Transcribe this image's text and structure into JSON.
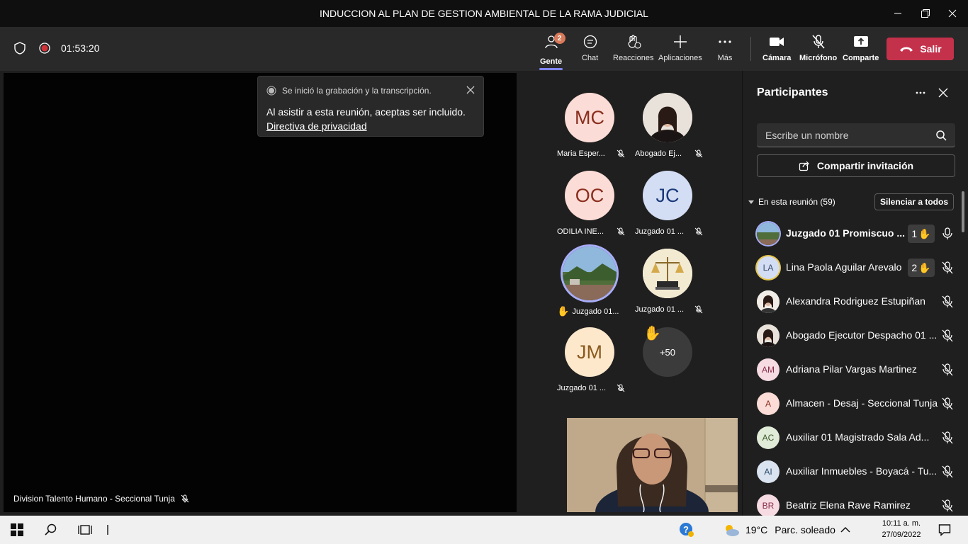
{
  "window": {
    "title": "INDUCCION AL PLAN DE GESTION AMBIENTAL DE LA RAMA JUDICIAL"
  },
  "toolbar": {
    "timer": "01:53:20",
    "people": {
      "label": "Gente",
      "badge": "2"
    },
    "chat": "Chat",
    "reactions": "Reacciones",
    "apps": "Aplicaciones",
    "more": "Más",
    "camera": "Cámara",
    "mic": "Micrófono",
    "share": "Comparte",
    "leave": "Salir"
  },
  "toast": {
    "header": "Se inició la grabación y la transcripción.",
    "body": "Al asistir a esta reunión, aceptas ser incluido.",
    "link": "Directiva de privacidad"
  },
  "stage": {
    "label": "Division Talento Humano - Seccional Tunja"
  },
  "gallery": [
    {
      "initials": "MC",
      "name": "Maria Esper...",
      "bg": "#fcdcd6",
      "fg": "#8a2e1e"
    },
    {
      "initials": "",
      "name": "Abogado Ej...",
      "bg": "#d8c8b8",
      "fg": "#000"
    },
    {
      "initials": "OC",
      "name": "ODILIA INE...",
      "bg": "#fcdcd6",
      "fg": "#8a2e1e"
    },
    {
      "initials": "JC",
      "name": "Juzgado 01 ...",
      "bg": "#d3def4",
      "fg": "#1b3a7a"
    },
    {
      "initials": "",
      "name": "Juzgado 01...",
      "bg": "#7f9a7f",
      "fg": "#000"
    },
    {
      "initials": "",
      "name": "Juzgado 01 ...",
      "bg": "#f3ead2",
      "fg": "#000"
    },
    {
      "initials": "JM",
      "name": "Juzgado 01 ...",
      "bg": "#fde8cc",
      "fg": "#8a5a1e"
    },
    {
      "initials": "+50",
      "name": "",
      "bg": "#3b3b3b",
      "fg": "#fff"
    }
  ],
  "panel": {
    "title": "Participantes",
    "search_placeholder": "Escribe un nombre",
    "share_invite": "Compartir invitación",
    "section": "En esta reunión (59)",
    "mute_all": "Silenciar a todos",
    "participants": [
      {
        "initials": "",
        "name": "Juzgado 01 Promiscuo ...",
        "hand": "1",
        "bg": "#6f8a6f",
        "fg": "#fff",
        "bold": true
      },
      {
        "initials": "LA",
        "name": "Lina Paola Aguilar Arevalo",
        "hand": "2",
        "bg": "#d3def4",
        "fg": "#3a4a6a",
        "bold": false
      },
      {
        "initials": "",
        "name": "Alexandra Rodriguez Estupiñan",
        "hand": "",
        "bg": "#f1ece6",
        "fg": "#000",
        "bold": false
      },
      {
        "initials": "",
        "name": "Abogado Ejecutor Despacho 01 ...",
        "hand": "",
        "bg": "#d8c8b8",
        "fg": "#000",
        "bold": false
      },
      {
        "initials": "AM",
        "name": "Adriana Pilar Vargas Martinez",
        "hand": "",
        "bg": "#f6dbe3",
        "fg": "#8a2e4a",
        "bold": false
      },
      {
        "initials": "A",
        "name": "Almacen - Desaj - Seccional Tunja",
        "hand": "",
        "bg": "#fcdcd6",
        "fg": "#8a2e1e",
        "bold": false
      },
      {
        "initials": "AC",
        "name": "Auxiliar 01 Magistrado Sala Ad...",
        "hand": "",
        "bg": "#e0ecd8",
        "fg": "#3a5a2a",
        "bold": false
      },
      {
        "initials": "AI",
        "name": "Auxiliar Inmuebles - Boyacá - Tu...",
        "hand": "",
        "bg": "#d9e4f0",
        "fg": "#2a4a6a",
        "bold": false
      },
      {
        "initials": "BR",
        "name": "Beatriz Elena Rave Ramirez",
        "hand": "",
        "bg": "#f6dbe3",
        "fg": "#8a2e4a",
        "bold": false
      }
    ]
  },
  "taskbar": {
    "weather_temp": "19°C",
    "weather_text": "Parc. soleado",
    "time": "10:11 a. m.",
    "date": "27/09/2022"
  }
}
